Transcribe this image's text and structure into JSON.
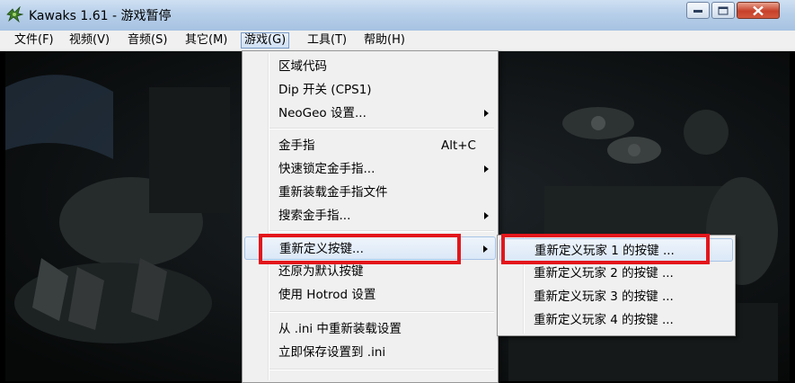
{
  "window": {
    "title": "Kawaks 1.61 - 游戏暂停"
  },
  "menubar": {
    "items": [
      {
        "label": "文件(F)"
      },
      {
        "label": "视频(V)"
      },
      {
        "label": "音频(S)"
      },
      {
        "label": "其它(M)"
      },
      {
        "label": "游戏(G)"
      },
      {
        "label": "工具(T)"
      },
      {
        "label": "帮助(H)"
      }
    ]
  },
  "game_menu": {
    "items": [
      {
        "label": "区域代码"
      },
      {
        "label": "Dip 开关 (CPS1)"
      },
      {
        "label": "NeoGeo 设置...",
        "submenu": true
      },
      {
        "label": "金手指",
        "shortcut": "Alt+C"
      },
      {
        "label": "快速锁定金手指...",
        "submenu": true
      },
      {
        "label": "重新装载金手指文件"
      },
      {
        "label": "搜索金手指...",
        "submenu": true
      },
      {
        "label": "重新定义按键...",
        "submenu": true,
        "highlighted": true
      },
      {
        "label": "还原为默认按键"
      },
      {
        "label": "使用 Hotrod 设置"
      },
      {
        "label": "从 .ini 中重新装载设置"
      },
      {
        "label": "立即保存设置到 .ini"
      }
    ]
  },
  "key_submenu": {
    "items": [
      {
        "label": "重新定义玩家 1 的按键 ...",
        "highlighted": true
      },
      {
        "label": "重新定义玩家 2 的按键 ..."
      },
      {
        "label": "重新定义玩家 3 的按键 ..."
      },
      {
        "label": "重新定义玩家 4 的按键 ..."
      }
    ]
  },
  "icons": {
    "app": "kawaks-app-icon",
    "minimize": "minimize-icon",
    "maximize": "maximize-icon",
    "close": "close-icon",
    "submenu_arrow": "submenu-arrow-icon"
  },
  "colors": {
    "highlight_box": "#e3161b",
    "menu_bg": "#f0f0f0",
    "titlebar": "#b7cfe9"
  }
}
